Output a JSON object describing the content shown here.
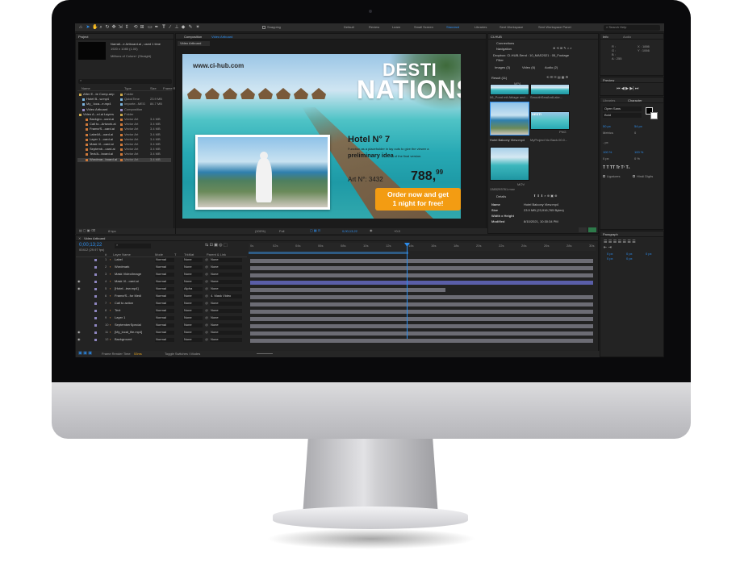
{
  "toolbar": {
    "workspaces": [
      "Default",
      "Review",
      "Learn",
      "Small Screen",
      "Standard",
      "Libraries",
      "Sent Workspace",
      "Sent Workspace Panel"
    ],
    "active_workspace": "Standard",
    "snapping": "Snapping",
    "search_placeholder": "Search Help"
  },
  "project": {
    "tab": "Project",
    "selected_name": "Narrati...e Artboard.ai , used 1 time",
    "selected_meta": "1920 x 1080 (1.00)",
    "selected_colors": "Millions of Colors+ (Straight)",
    "columns": [
      "Name",
      "Type",
      "Size",
      "Frame R..."
    ],
    "rows": [
      {
        "name": "After E...te Comp.aep",
        "type": "Folder",
        "size": "",
        "color": "#c9a64a"
      },
      {
        "name": "Hotel B...w.mp4",
        "type": "QuickTime",
        "size": "23.9 MB",
        "color": "#7cb5e0"
      },
      {
        "name": "My_ loca...e.mp4",
        "type": "Importe...MEG",
        "size": "84.7 MB",
        "color": "#7cb5e0"
      },
      {
        "name": "Video Artboard",
        "type": "Composition",
        "size": "",
        "color": "#9a8ec9"
      },
      {
        "name": "Video A...rd.ai Layers",
        "type": "Folder",
        "size": "",
        "color": "#c9a64a"
      },
      {
        "name": "Backgro...oard.ai",
        "type": "Vector Art",
        "size": "3.4 MB",
        "color": "#d07a3a"
      },
      {
        "name": "Call to...Artwork.ai",
        "type": "Vector Art",
        "size": "3.4 MB",
        "color": "#d07a3a"
      },
      {
        "name": "Frame/S...oard.ai",
        "type": "Vector Art",
        "size": "3.4 MB",
        "color": "#d07a3a"
      },
      {
        "name": "Label/A...oard.ai",
        "type": "Vector Art",
        "size": "3.4 MB",
        "color": "#d07a3a"
      },
      {
        "name": "Layer 1...oard.ai",
        "type": "Vector Art",
        "size": "3.4 MB",
        "color": "#d07a3a"
      },
      {
        "name": "Mask Vi...oard.ai",
        "type": "Vector Art",
        "size": "3.4 MB",
        "color": "#d07a3a"
      },
      {
        "name": "Septemb...oard.ai",
        "type": "Vector Art",
        "size": "3.4 MB",
        "color": "#d07a3a"
      },
      {
        "name": "Text/A...board.ai",
        "type": "Vector Art",
        "size": "3.4 MB",
        "color": "#d07a3a"
      },
      {
        "name": "Wordmar...board.ai",
        "type": "Vector Art",
        "size": "3.4 MB",
        "color": "#d07a3a"
      }
    ],
    "bpc": "8 bpc"
  },
  "composition": {
    "tab": "Composition",
    "name": "Video Artboard",
    "sub_tab": "Video Artboard",
    "zoom": "(100%)",
    "quality": "Full",
    "timecode": "0;00;13;22",
    "exposure": "+0.0",
    "artwork": {
      "url": "www.ci-hub.com",
      "headline_line1": "DESTI",
      "headline_line2": "NATIONS",
      "hotel_title": "Hotel N° 7",
      "description_before": "Function as a placeholder in lay outs to give the viewer a ",
      "description_bold": "preliminary idea",
      "description_after": " of the final version.",
      "article": "Art N°: 3432",
      "price_main": "788,",
      "price_cents": "99",
      "cta_line1": "Order now and get",
      "cta_line2": "1 night for free!"
    }
  },
  "chub": {
    "tab": "CI-HUB",
    "connections": "Connections",
    "navigation": "Navigation",
    "path": "Dropbox: CI-HUB-Send : 10_MAS2021 : 05_Footage",
    "filter": "Filter",
    "filters": [
      "Images (3)",
      "Video (6)",
      "Audio (2)"
    ],
    "result": "Result (11)",
    "thumbs": [
      {
        "label": "06_Pond mit Ablage und...",
        "badge": "MP4"
      },
      {
        "label": "SmoothSeaAndLake...",
        "badge": ""
      },
      {
        "label": "Hotel Balcony View.mp4",
        "badge": ""
      },
      {
        "label": "MyProject No Back.00.0...",
        "badge": "PNG"
      },
      {
        "label": "1383293761.mov",
        "badge": "MOV"
      }
    ],
    "details": "Details",
    "detail_rows": [
      {
        "k": "Name",
        "v": "Hotel Balcony View.mp4"
      },
      {
        "k": "Size",
        "v": "23.9 MB (23,916,765 Bytes)"
      },
      {
        "k": "Width x Height",
        "v": ""
      },
      {
        "k": "Modified",
        "v": "8/10/2021, 10:30:34 PM"
      }
    ]
  },
  "right": {
    "info_tab": "Info",
    "audio_tab": "Audio",
    "info_values": [
      "R :",
      "G :",
      "B :",
      "A : 255",
      "X : 1886",
      "Y : 1066"
    ],
    "preview_tab": "Preview",
    "libraries_tab": "Libraries",
    "character_tab": "Character",
    "font": "Open Sans",
    "style": "Bold",
    "font_size": "50 px",
    "leading": "54 px",
    "metrics": "Metrics",
    "tracking": "0",
    "px": "- px",
    "v_scale": "100 %",
    "h_scale": "100 %",
    "baseline": "0 px",
    "tsume": "0 %",
    "ligatures": "Ligatures",
    "hindi": "Hindi Digits",
    "paragraph_tab": "Paragraph",
    "para_values": [
      "0 px",
      "0 px",
      "0 px",
      "0 px",
      "0 px"
    ]
  },
  "timeline": {
    "tab": "Video Artboard",
    "timecode": "0;00;13;22",
    "fps": "00412 (29.97 fps)",
    "columns": [
      "#",
      "Layer Name",
      "Mode",
      "T",
      "TrkMat",
      "Parent & Link"
    ],
    "layers": [
      {
        "n": "1",
        "name": "Label",
        "mode": "Normal",
        "trk": "None",
        "parent": "None"
      },
      {
        "n": "2",
        "name": "Wordmark",
        "mode": "Normal",
        "trk": "None",
        "parent": "None"
      },
      {
        "n": "3",
        "name": "Mask Video/Image",
        "mode": "Normal",
        "trk": "None",
        "parent": "None"
      },
      {
        "n": "4",
        "name": "Mask Vi...oard.ai",
        "mode": "Normal",
        "trk": "None",
        "parent": "None"
      },
      {
        "n": "5",
        "name": "[Hotel...iew.mp4]",
        "mode": "Normal",
        "trk": "Alpha",
        "parent": "None"
      },
      {
        "n": "6",
        "name": "Frame/S...for Medi",
        "mode": "Normal",
        "trk": "None",
        "parent": "4. Mask Video"
      },
      {
        "n": "7",
        "name": "Call to action",
        "mode": "Normal",
        "trk": "None",
        "parent": "None"
      },
      {
        "n": "8",
        "name": "Text",
        "mode": "Normal",
        "trk": "None",
        "parent": "None"
      },
      {
        "n": "9",
        "name": "Layer 1",
        "mode": "Normal",
        "trk": "None",
        "parent": "None"
      },
      {
        "n": "10",
        "name": "SeptemberSpecial",
        "mode": "Normal",
        "trk": "None",
        "parent": "None"
      },
      {
        "n": "11",
        "name": "[My_local_file.mp4]",
        "mode": "Normal",
        "trk": "None",
        "parent": "None"
      },
      {
        "n": "12",
        "name": "Background",
        "mode": "Normal",
        "trk": "None",
        "parent": "None"
      }
    ],
    "ruler": [
      "0s",
      "02s",
      "04s",
      "06s",
      "08s",
      "10s",
      "12s",
      "14s",
      "16s",
      "18s",
      "20s",
      "22s",
      "24s",
      "26s",
      "28s",
      "30s"
    ],
    "render_label": "Frame Render Time",
    "render_time": "53ms",
    "toggle": "Toggle Switches / Modes"
  }
}
